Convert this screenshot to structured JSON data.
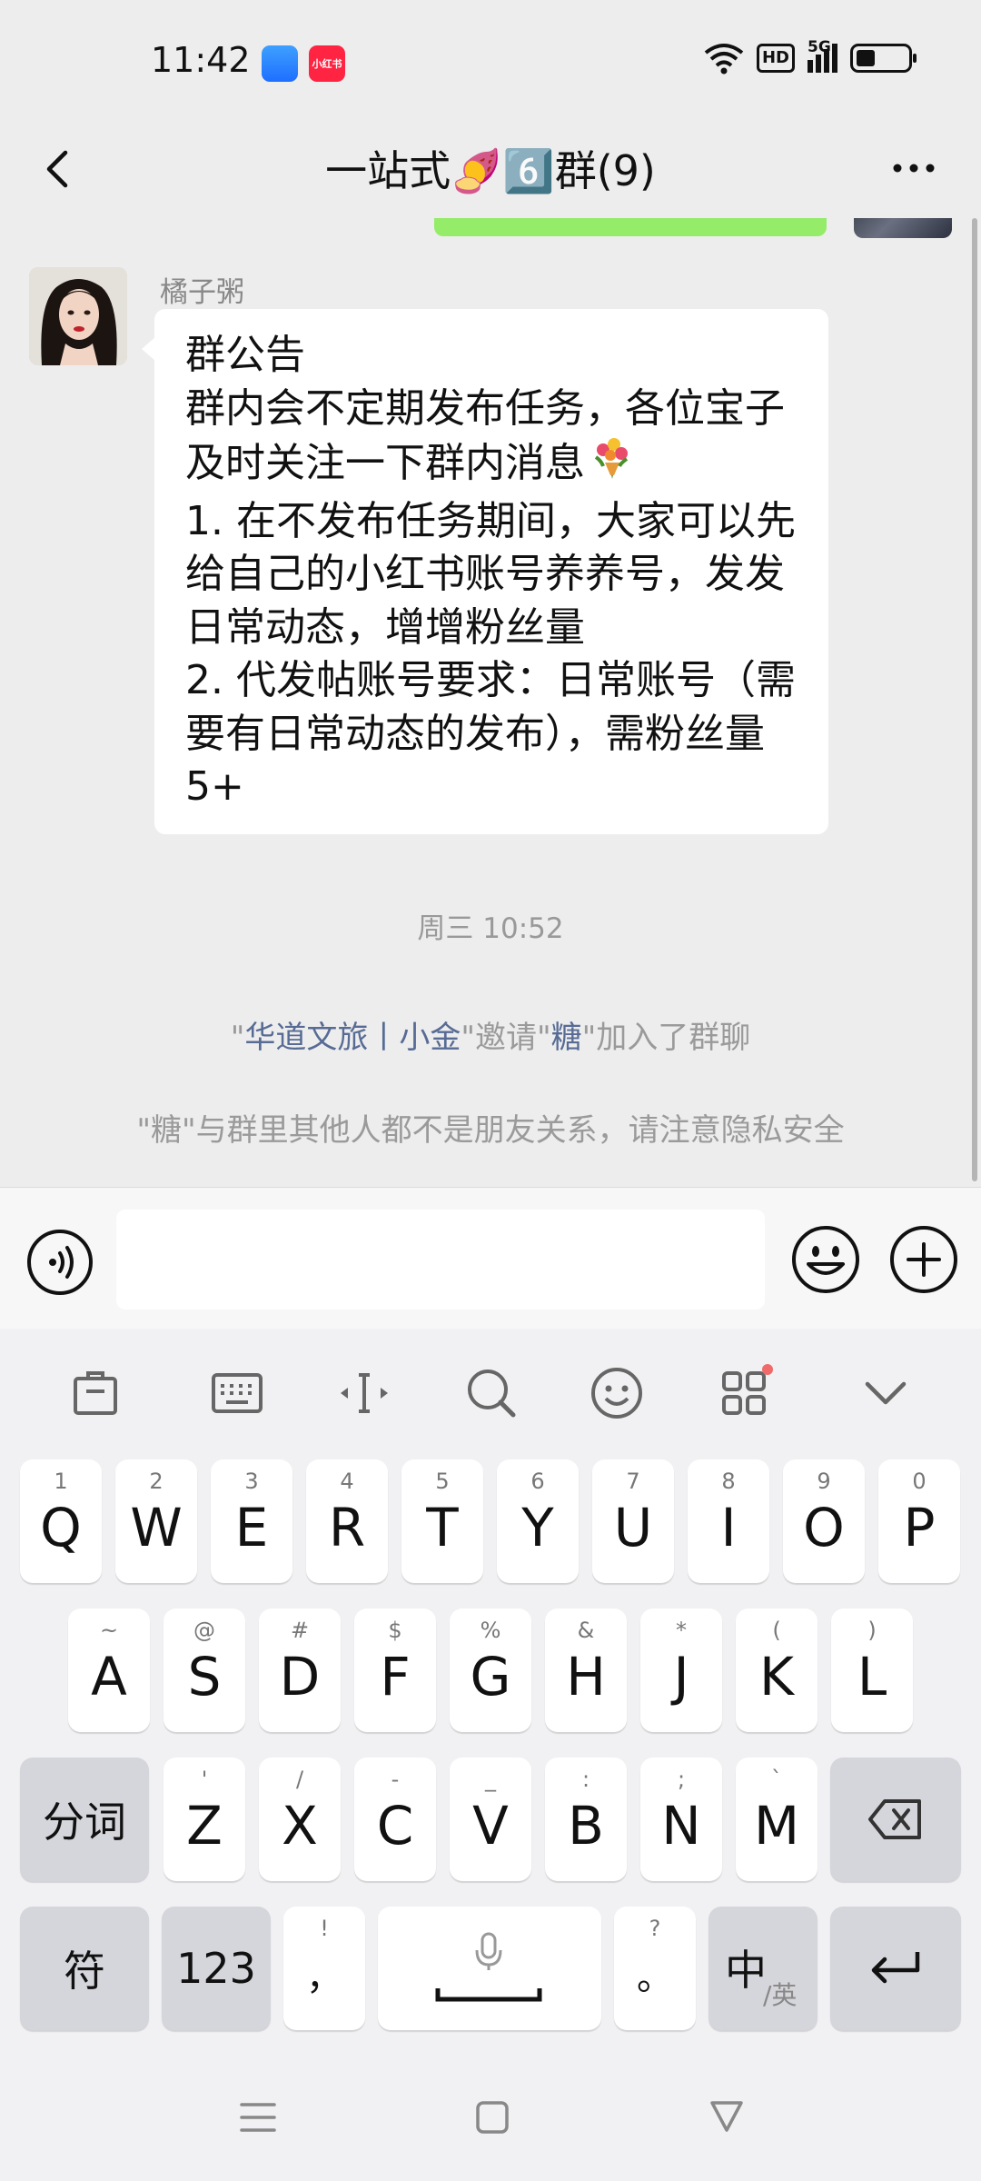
{
  "status_bar": {
    "time": "11:42",
    "app_badges": [
      "",
      "小红书"
    ],
    "hd_label": "HD",
    "network_label": "5G"
  },
  "nav": {
    "title": "一站式🍠6️⃣群(9)"
  },
  "chat": {
    "sender_name": "橘子粥",
    "announcement_lines": [
      "群公告",
      "群内会不定期发布任务，各位宝子",
      "及时关注一下群内消息",
      "1. 在不发布任务期间，大家可以先",
      "给自己的小红书账号养养号，发发",
      "日常动态，增增粉丝量",
      "2. 代发帖账号要求：日常账号（需",
      "要有日常动态的发布），需粉丝量",
      "5+"
    ],
    "flower_emoji": "💐",
    "time_separator": "周三 10:52",
    "invite_msg": {
      "q1": "\"",
      "inviter": "华道文旅丨小金",
      "mid": "\"邀请\"",
      "invitee": "糖",
      "tail": "\"加入了群聊"
    },
    "privacy_msg": "\"糖\"与群里其他人都不是朋友关系，请注意隐私安全"
  },
  "input_bar": {
    "value": "",
    "placeholder": ""
  },
  "keyboard": {
    "toolbar_icons": [
      "clipboard-icon",
      "keyboard-icon",
      "cursor-icon",
      "search-icon",
      "emoji-icon",
      "apps-icon",
      "collapse-icon"
    ],
    "row1": [
      {
        "hint": "1",
        "key": "Q"
      },
      {
        "hint": "2",
        "key": "W"
      },
      {
        "hint": "3",
        "key": "E"
      },
      {
        "hint": "4",
        "key": "R"
      },
      {
        "hint": "5",
        "key": "T"
      },
      {
        "hint": "6",
        "key": "Y"
      },
      {
        "hint": "7",
        "key": "U"
      },
      {
        "hint": "8",
        "key": "I"
      },
      {
        "hint": "9",
        "key": "O"
      },
      {
        "hint": "0",
        "key": "P"
      }
    ],
    "row2": [
      {
        "hint": "~",
        "key": "A"
      },
      {
        "hint": "@",
        "key": "S"
      },
      {
        "hint": "#",
        "key": "D"
      },
      {
        "hint": "$",
        "key": "F"
      },
      {
        "hint": "%",
        "key": "G"
      },
      {
        "hint": "&",
        "key": "H"
      },
      {
        "hint": "*",
        "key": "J"
      },
      {
        "hint": "(",
        "key": "K"
      },
      {
        "hint": ")",
        "key": "L"
      }
    ],
    "row3": [
      {
        "hint": "'",
        "key": "Z"
      },
      {
        "hint": "/",
        "key": "X"
      },
      {
        "hint": "-",
        "key": "C"
      },
      {
        "hint": "_",
        "key": "V"
      },
      {
        "hint": ":",
        "key": "B"
      },
      {
        "hint": ";",
        "key": "N"
      },
      {
        "hint": "`",
        "key": "M"
      }
    ],
    "fenci_label": "分词",
    "symbol_label": "符",
    "numeric_label": "123",
    "comma_hint": "!",
    "comma_key": "，",
    "period_hint": "?",
    "period_key": "。",
    "lang_main": "中",
    "lang_sub": "/英"
  }
}
